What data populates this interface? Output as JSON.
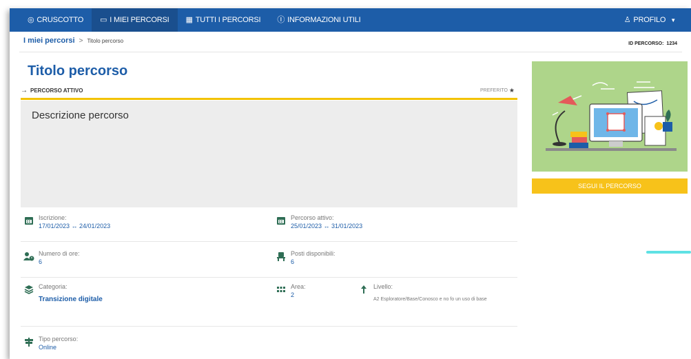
{
  "nav": {
    "items": [
      {
        "label": "CRUSCOTTO",
        "icon": "dashboard-icon",
        "glyph": "◎"
      },
      {
        "label": "I MIEI PERCORSI",
        "icon": "monitor-icon",
        "glyph": "▭"
      },
      {
        "label": "TUTTI I PERCORSI",
        "icon": "grid-icon",
        "glyph": "▦"
      },
      {
        "label": "INFORMAZIONI UTILI",
        "icon": "info-icon",
        "glyph": "ⓘ"
      }
    ],
    "profile": {
      "label": "PROFILO",
      "icon": "user-icon",
      "glyph": "♙",
      "caret": "▼"
    },
    "colors": {
      "bar": "#1d5da8",
      "active": "#1a4f8e"
    }
  },
  "breadcrumb": {
    "link": "I miei percorsi",
    "separator": ">",
    "current": "Titolo percorso"
  },
  "id_percorso": {
    "label": "ID PERCORSO:",
    "value": "1234"
  },
  "title": "Titolo percorso",
  "status": {
    "label": "PERCORSO ATTIVO",
    "favorite": "PREFERITO"
  },
  "description": "Descrizione percorso",
  "follow_button": "SEGUI IL PERCORSO",
  "fields": {
    "iscrizione": {
      "label": "Iscrizione:",
      "value": "17/01/2023 ↔ 24/01/2023",
      "icon": "calendar-icon"
    },
    "percorso_attivo": {
      "label": "Percorso attivo:",
      "value": "25/01/2023 ↔ 31/01/2023",
      "icon": "calendar-icon"
    },
    "numero_ore": {
      "label": "Numero di ore:",
      "value": "6",
      "icon": "people-clock-icon"
    },
    "posti": {
      "label": "Posti disponibili:",
      "value": "6",
      "icon": "seat-icon"
    },
    "categoria": {
      "label": "Categoria:",
      "value": "Transizione digitale",
      "icon": "layers-icon"
    },
    "area": {
      "label": "Area:",
      "value": "2",
      "icon": "apps-icon"
    },
    "livello": {
      "label": "Livello:",
      "value": "A2 Esploratore/Base/Conosco e no fo un uso di base",
      "icon": "level-arrow-icon"
    },
    "tipo": {
      "label": "Tipo percorso:",
      "value": "Online",
      "icon": "signpost-icon"
    }
  },
  "accent_colors": {
    "yellow": "#f2c200",
    "green_icons": "#2f6e55",
    "cyan": "#5fe1e4",
    "illustration_bg": "#aed58a"
  }
}
